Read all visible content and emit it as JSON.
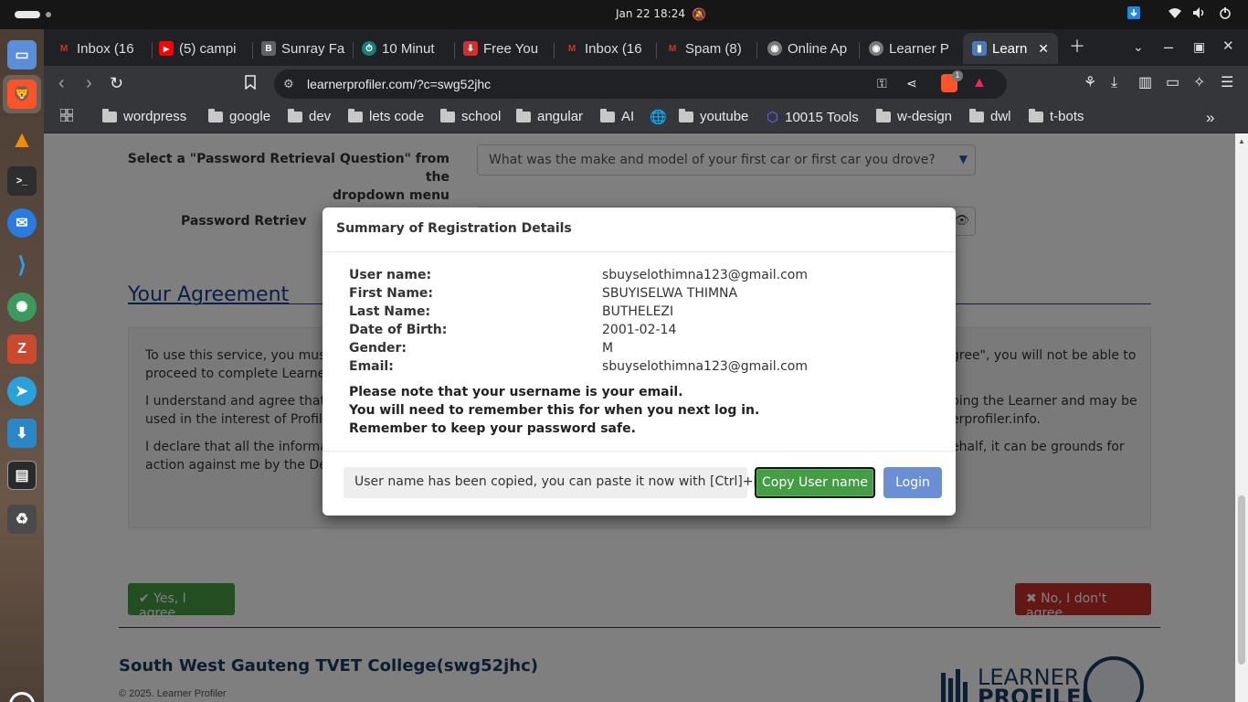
{
  "os": {
    "clock": "Jan 22  18:24"
  },
  "tabs": [
    {
      "label": "Inbox (16",
      "icon": "gmail-icon",
      "color": "#d93025",
      "glyph": "M"
    },
    {
      "label": "(5) campi",
      "icon": "youtube-icon",
      "color": "#ff0000",
      "glyph": "▶"
    },
    {
      "label": "Sunray Fa",
      "icon": "page-icon",
      "color": "#5f6368",
      "glyph": "B"
    },
    {
      "label": "10 Minut",
      "icon": "globe-icon",
      "color": "#1a7f7a",
      "glyph": "⏱"
    },
    {
      "label": "Free You",
      "icon": "download-icon",
      "color": "#d32f2f",
      "glyph": "⬇"
    },
    {
      "label": "Inbox (16",
      "icon": "gmail-icon",
      "color": "#d93025",
      "glyph": "M"
    },
    {
      "label": "Spam (8)",
      "icon": "gmail-icon",
      "color": "#d93025",
      "glyph": "M"
    },
    {
      "label": "Online Ap",
      "icon": "seal-icon",
      "color": "#7a7a7a",
      "glyph": "◉"
    },
    {
      "label": "Learner P",
      "icon": "seal-icon",
      "color": "#7a7a7a",
      "glyph": "◉"
    },
    {
      "label": "Learn",
      "icon": "learner-profiler-icon",
      "color": "#4a7ab8",
      "glyph": "▮"
    }
  ],
  "address": {
    "url": "learnerprofiler.com/?c=swg52jhc",
    "brave_badge": "1"
  },
  "bookmarks": [
    {
      "label": "wordpress",
      "type": "folder"
    },
    {
      "label": "google",
      "type": "folder"
    },
    {
      "label": "dev",
      "type": "folder"
    },
    {
      "label": "lets code",
      "type": "folder"
    },
    {
      "label": "school",
      "type": "folder"
    },
    {
      "label": "angular",
      "type": "folder"
    },
    {
      "label": "AI",
      "type": "folder"
    },
    {
      "label": "",
      "type": "globe"
    },
    {
      "label": "youtube",
      "type": "folder"
    },
    {
      "label": "10015 Tools",
      "type": "tools"
    },
    {
      "label": "w-design",
      "type": "folder"
    },
    {
      "label": "dwl",
      "type": "folder"
    },
    {
      "label": "t-bots",
      "type": "folder"
    }
  ],
  "form": {
    "question_label": "Select a \"Password Retrieval Question\" from the dropdown menu",
    "question_label_line1": "Select a \"Password Retrieval Question\" from the",
    "question_label_line2": "dropdown menu",
    "question_value": "What was the make and model of your first car or first car you drove?",
    "answer_label": "Password Retriev"
  },
  "agreement": {
    "title": "Your Agreement",
    "p1a": "To use this service, you must c",
    "p1a_end": "gree\", you will not be able to",
    "p1b": "proceed to complete Learner",
    "p2a": "I understand and agree that th",
    "p2a_end": "ping the Learner and may be",
    "p2b": "used in the interest of Profiler",
    "p2b_end": "erprofiler.info.",
    "p3a": "I declare that all the informati",
    "p3a_end": "ehalf, it can be grounds for",
    "p3b": "action against me by the Depa",
    "yes_label": "✔ Yes, I agree",
    "no_label": "✖ No, I don't agree"
  },
  "footer": {
    "college": "South West Gauteng TVET College(swg52jhc)",
    "copyright": "© 2025. Learner Profiler",
    "logo_line1": "LEARNER",
    "logo_line2": "PROFILER"
  },
  "modal": {
    "title": "Summary of Registration Details",
    "details": [
      {
        "key": "User name:",
        "value": "sbuyselothimna123@gmail.com"
      },
      {
        "key": "First Name:",
        "value": "SBUYISELWA THIMNA"
      },
      {
        "key": "Last Name:",
        "value": "BUTHELEZI"
      },
      {
        "key": "Date of Birth:",
        "value": "2001-02-14"
      },
      {
        "key": "Gender:",
        "value": "M"
      },
      {
        "key": "Email:",
        "value": "sbuyselothimna123@gmail.com"
      }
    ],
    "notes": [
      "Please note that your username is your email.",
      "You will need to remember this for when you next log in.",
      "Remember to keep your password safe."
    ],
    "copied_message": "User name has been copied, you can paste it now with [Ctrl]+[V]",
    "copy_button": "Copy User name",
    "login_button": "Login"
  },
  "colors": {
    "success": "#449d44",
    "danger": "#c9302c",
    "primary_light": "#6b8fd4",
    "heading": "#1a3d8f"
  }
}
